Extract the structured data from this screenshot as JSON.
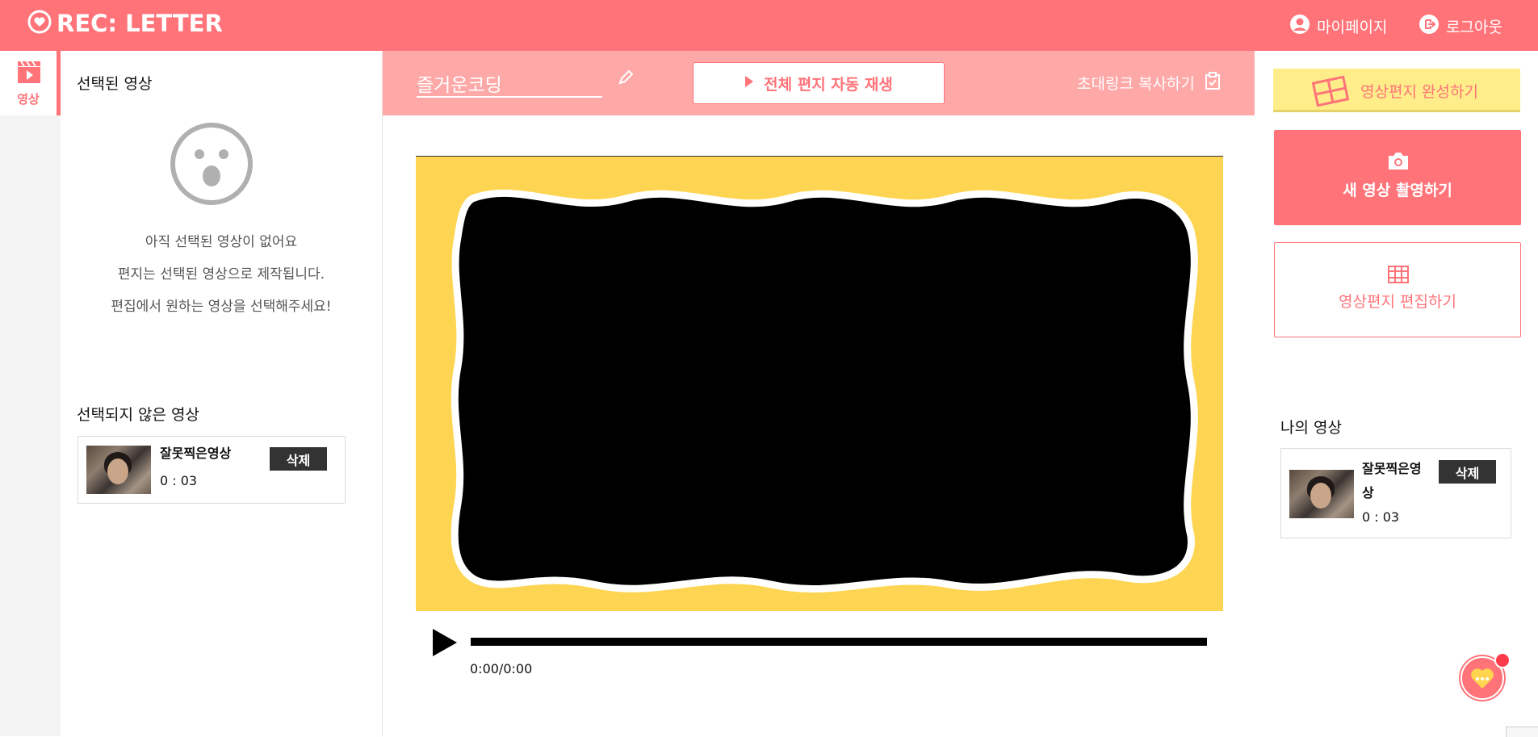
{
  "header": {
    "logo_text": "REC: LETTER",
    "mypage": "마이페이지",
    "logout": "로그아웃"
  },
  "rail": {
    "video_label": "영상"
  },
  "left": {
    "selected_title": "선택된 영상",
    "empty_lines": [
      "아직 선택된 영상이 없어요",
      "편지는 선택된 영상으로 제작됩니다.",
      "편집에서 원하는 영상을 선택해주세요!"
    ],
    "unselected_title": "선택되지 않은 영상",
    "unselected_videos": [
      {
        "name": "잘못찍은영상",
        "duration": "0 : 03",
        "delete_label": "삭제"
      }
    ]
  },
  "topbar": {
    "title_value": "즐거운코딩",
    "play_all": "전체 편지 자동 재생",
    "invite": "초대링크 복사하기"
  },
  "player": {
    "timecode": "0:00/0:00",
    "progress": 0
  },
  "right": {
    "done": "영상편지 완성하기",
    "record": "새 영상 촬영하기",
    "edit": "영상편지 편집하기",
    "my_videos_title": "나의 영상",
    "my_videos": [
      {
        "name": "잘못찍은영상",
        "duration": "0 : 03",
        "delete_label": "삭제"
      }
    ]
  },
  "colors": {
    "accent": "#ff7379",
    "topbar": "#ffa8a8",
    "player_bg": "#fdd552",
    "done_btn": "#ffed8a"
  }
}
